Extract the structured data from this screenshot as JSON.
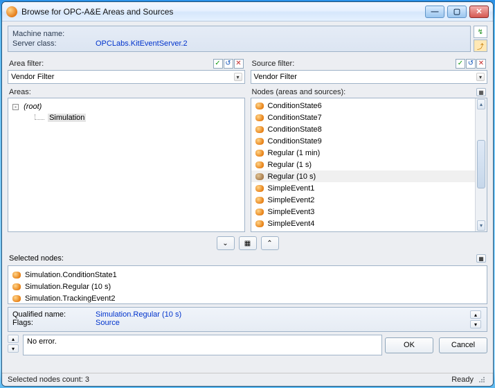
{
  "title": "Browse for OPC-A&E Areas and Sources",
  "machine": {
    "name_label": "Machine name:",
    "name_value": "",
    "class_label": "Server class:",
    "class_value": "OPCLabs.KitEventServer.2"
  },
  "area": {
    "label": "Area filter:",
    "combo": "Vendor Filter",
    "panel_label": "Areas:",
    "tree_root": "(root)",
    "tree_child": "Simulation"
  },
  "source": {
    "label": "Source filter:",
    "combo": "Vendor Filter",
    "panel_label": "Nodes (areas and sources):",
    "items": [
      "ConditionState6",
      "ConditionState7",
      "ConditionState8",
      "ConditionState9",
      "Regular (1 min)",
      "Regular (1 s)",
      "Regular (10 s)",
      "SimpleEvent1",
      "SimpleEvent2",
      "SimpleEvent3",
      "SimpleEvent4"
    ],
    "highlight_index": 6
  },
  "selected": {
    "label": "Selected nodes:",
    "items": [
      "Simulation.ConditionState1",
      "Simulation.Regular (10 s)",
      "Simulation.TrackingEvent2"
    ]
  },
  "info": {
    "qn_label": "Qualified name:",
    "qn_value": "Simulation.Regular (10 s)",
    "flags_label": "Flags:",
    "flags_value": "Source"
  },
  "msg": "No error.",
  "buttons": {
    "ok": "OK",
    "cancel": "Cancel"
  },
  "status": {
    "count": "Selected nodes count: 3",
    "ready": "Ready"
  }
}
